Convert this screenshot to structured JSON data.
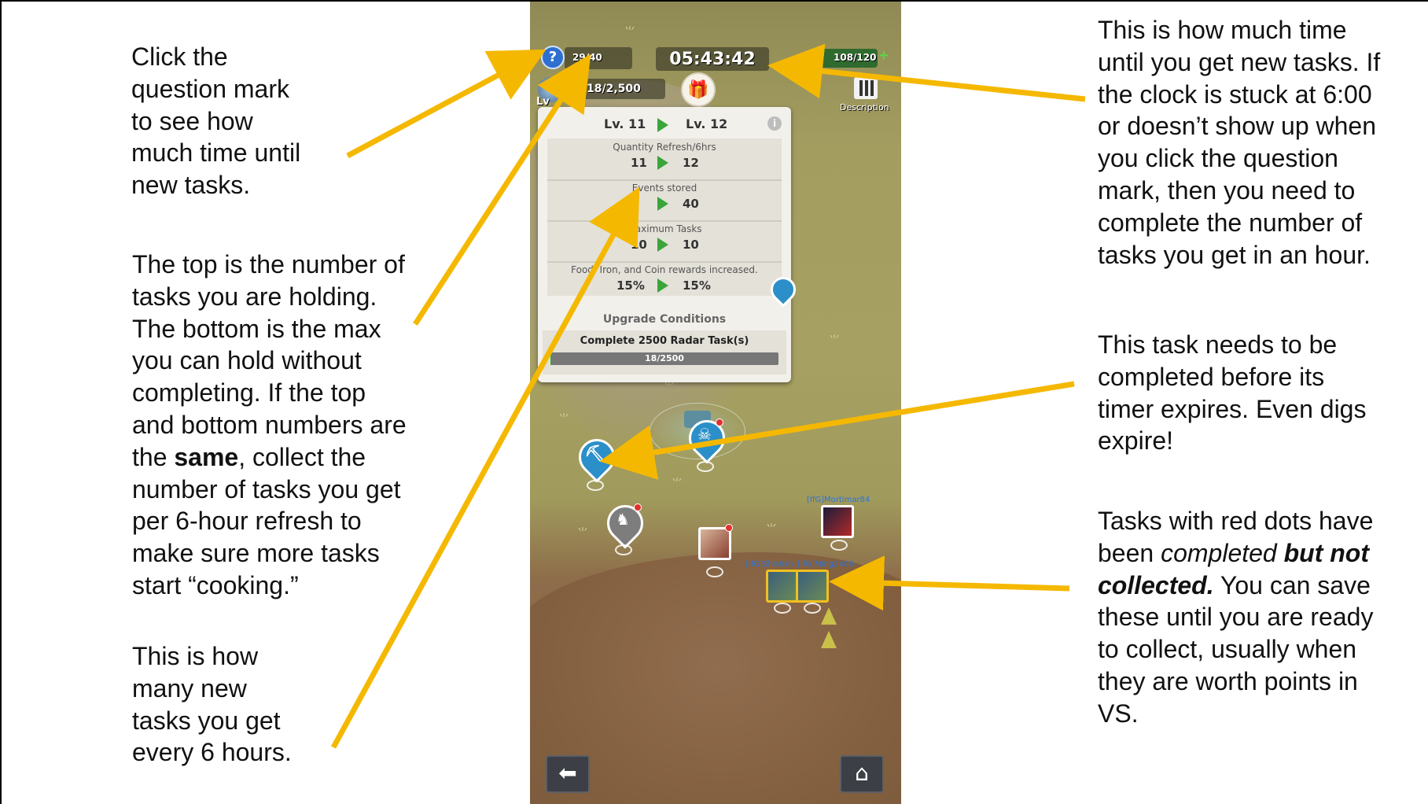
{
  "annotations": {
    "question_mark": [
      "Click the",
      "question mark",
      "to see how",
      "much time until",
      "new tasks."
    ],
    "holding": [
      [
        "The top is the number of"
      ],
      [
        "tasks you are holding."
      ],
      [
        "The bottom is the max"
      ],
      [
        "you can hold without"
      ],
      [
        "completing. If the top"
      ],
      [
        "and bottom numbers are"
      ],
      [
        "the ",
        "same",
        ", collect the"
      ],
      [
        "number of tasks you get"
      ],
      [
        "per 6-hour refresh to"
      ],
      [
        "make sure more tasks"
      ],
      [
        "start “cooking.”"
      ]
    ],
    "new_tasks": [
      "This is how",
      "many new",
      "tasks you get",
      "every 6 hours."
    ],
    "timer": [
      "This is how much time",
      "until you get new tasks. If",
      "the clock is stuck at 6:00",
      "or doesn’t show up when",
      "you click the question",
      "mark, then you need to",
      "complete the number of",
      "tasks you get in an hour."
    ],
    "expire": [
      "This task needs to be",
      "completed before its",
      "timer expires. Even digs",
      "expire!"
    ],
    "red_dots": {
      "line1": "Tasks with red dots have",
      "line2_pre": "been ",
      "line2_italic": "completed",
      "line2_bolditalic": " but not",
      "line3_bolditalic": "collected.",
      "line3_rest": " You can save",
      "line4": "these until you are ready",
      "line5": "to collect, usually when",
      "line6": "they are worth points in",
      "line7": "VS."
    }
  },
  "game": {
    "held_tasks": "29/40",
    "timer": "05:43:42",
    "energy": "108/120",
    "radar_progress": "18/2,500",
    "level_short": "Lv",
    "description_label": "Description",
    "panel": {
      "from_level": "Lv. 11",
      "to_level": "Lv. 12",
      "rows": [
        {
          "label": "Quantity Refresh/6hrs",
          "from": "11",
          "to": "12"
        },
        {
          "label": "Events stored",
          "from": "",
          "to": "40"
        },
        {
          "label": "Maximum Tasks",
          "from": "10",
          "to": "10"
        },
        {
          "label": "Food, Iron, and Coin rewards increased.",
          "from": "15%",
          "to": "15%"
        }
      ],
      "conditions_title": "Upgrade Conditions",
      "condition_text": "Complete 2500 Radar Task(s)",
      "condition_progress_text": "18/2500",
      "condition_progress_fraction": 0.0072
    },
    "players": [
      "[IfG]Mortimar84",
      "[IfG]Shishsh",
      "[IfG]Ming2408"
    ]
  },
  "colors": {
    "arrow": "#f5b800",
    "pin_blue": "#2b8fc9",
    "pin_gray": "#7d7d7d"
  }
}
